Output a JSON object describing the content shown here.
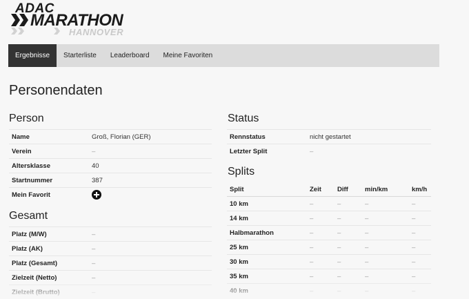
{
  "logo": {
    "brand": "ADAC",
    "name": "MARATHON",
    "city": "HANNOVER"
  },
  "nav": {
    "tabs": [
      {
        "label": "Ergebnisse"
      },
      {
        "label": "Starterliste"
      },
      {
        "label": "Leaderboard"
      },
      {
        "label": "Meine Favoriten"
      }
    ]
  },
  "page": {
    "title": "Personendaten"
  },
  "person": {
    "title": "Person",
    "rows": [
      {
        "label": "Name",
        "value": "Groß, Florian (GER)"
      },
      {
        "label": "Verein",
        "value": "–"
      },
      {
        "label": "Altersklasse",
        "value": "40"
      },
      {
        "label": "Startnummer",
        "value": "387"
      },
      {
        "label": "Mein Favorit",
        "icon": "plus-circle-icon"
      }
    ]
  },
  "gesamt": {
    "title": "Gesamt",
    "rows": [
      {
        "label": "Platz (M/W)",
        "value": "–"
      },
      {
        "label": "Platz (AK)",
        "value": "–"
      },
      {
        "label": "Platz (Gesamt)",
        "value": "–"
      },
      {
        "label": "Zielzeit (Netto)",
        "value": "–"
      },
      {
        "label": "Zielzeit (Brutto)",
        "value": "–"
      }
    ]
  },
  "status": {
    "title": "Status",
    "rows": [
      {
        "label": "Rennstatus",
        "value": "nicht gestartet"
      },
      {
        "label": "Letzter Split",
        "value": "–"
      }
    ]
  },
  "splits": {
    "title": "Splits",
    "headers": [
      "Split",
      "Zeit",
      "Diff",
      "min/km",
      "km/h"
    ],
    "rows": [
      {
        "name": "10 km",
        "zeit": "–",
        "diff": "–",
        "minkm": "–",
        "kmh": "–"
      },
      {
        "name": "14 km",
        "zeit": "–",
        "diff": "–",
        "minkm": "–",
        "kmh": "–"
      },
      {
        "name": "Halbmarathon",
        "zeit": "–",
        "diff": "–",
        "minkm": "–",
        "kmh": "–"
      },
      {
        "name": "25 km",
        "zeit": "–",
        "diff": "–",
        "minkm": "–",
        "kmh": "–"
      },
      {
        "name": "30 km",
        "zeit": "–",
        "diff": "–",
        "minkm": "–",
        "kmh": "–"
      },
      {
        "name": "35 km",
        "zeit": "–",
        "diff": "–",
        "minkm": "–",
        "kmh": "–"
      },
      {
        "name": "40 km",
        "zeit": "–",
        "diff": "–",
        "minkm": "–",
        "kmh": "–"
      }
    ]
  },
  "colors": {
    "nav_active_bg": "#333333",
    "nav_bg": "#dcdcdc",
    "page_bg": "#f7f7f7"
  }
}
